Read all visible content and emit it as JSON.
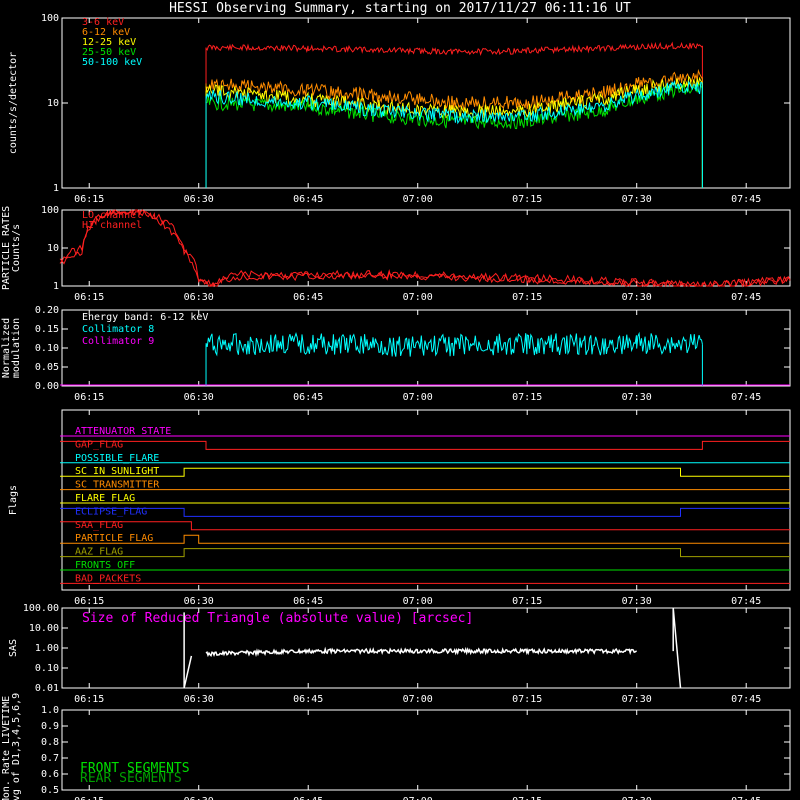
{
  "title": "HESSI Observing Summary, starting on 2017/11/27 06:11:16 UT",
  "colors": {
    "background": "#000000",
    "axes": "#ffffff",
    "red": "#ff2020",
    "orange": "#ff8c00",
    "yellow": "#ffff00",
    "green": "#00e000",
    "cyan": "#00ffff",
    "magenta": "#ff00ff",
    "blue": "#2030ff",
    "olive": "#a0a000",
    "white": "#ffffff"
  },
  "time_ticks": [
    "06:15",
    "06:30",
    "06:45",
    "07:00",
    "07:15",
    "07:30",
    "07:45"
  ],
  "chart_data": [
    {
      "type": "line",
      "name": "count-rates",
      "ylabel": "counts/s/detector",
      "yscale": "log",
      "ylim": [
        1,
        100
      ],
      "ytick_labels": [
        "1",
        "10",
        "100"
      ],
      "x": [
        "06:11",
        "06:31",
        "06:45",
        "06:55",
        "07:05",
        "07:15",
        "07:25",
        "07:35",
        "07:39",
        "07:51"
      ],
      "series": [
        {
          "name": "3-6 keV",
          "color": "#ff2020",
          "values": [
            1,
            45,
            44,
            42,
            40,
            41,
            44,
            47,
            47,
            1
          ]
        },
        {
          "name": "6-12 keV",
          "color": "#ff8c00",
          "values": [
            1,
            17,
            14,
            12,
            10,
            10,
            13,
            20,
            20,
            1
          ]
        },
        {
          "name": "12-25 keV",
          "color": "#ffff00",
          "values": [
            1,
            14,
            11,
            9,
            8,
            8,
            11,
            17,
            17,
            1
          ]
        },
        {
          "name": "25-50 keV",
          "color": "#00e000",
          "values": [
            1,
            10,
            9,
            7,
            6,
            6,
            8,
            14,
            14,
            1
          ]
        },
        {
          "name": "50-100 keV",
          "color": "#00ffff",
          "values": [
            1,
            12,
            10,
            8,
            7,
            7,
            9,
            15,
            15,
            1
          ]
        }
      ]
    },
    {
      "type": "line",
      "name": "particle-rates",
      "ylabel": "PARTICLE RATES\nCounts/s",
      "yscale": "log",
      "ylim": [
        1,
        100
      ],
      "ytick_labels": [
        "1",
        "10",
        "100"
      ],
      "x": [
        "06:11",
        "06:14",
        "06:16",
        "06:18",
        "06:20",
        "06:22",
        "06:24",
        "06:26",
        "06:28",
        "06:30",
        "06:32",
        "06:35",
        "07:00",
        "07:39",
        "07:51"
      ],
      "series": [
        {
          "name": "LO channel",
          "color": "#ff2020",
          "values": [
            5,
            10,
            60,
            95,
            100,
            90,
            70,
            40,
            10,
            1.5,
            1,
            2,
            2,
            1,
            1.5
          ]
        },
        {
          "name": "HI channel",
          "color": "#ff2020",
          "values": [
            4,
            8,
            50,
            85,
            95,
            85,
            60,
            30,
            8,
            1.2,
            1,
            1.8,
            1.8,
            1,
            1.4
          ]
        }
      ]
    },
    {
      "type": "line",
      "name": "modulation",
      "ylabel": "Normalized\nmodulation",
      "ylim": [
        0,
        0.2
      ],
      "ytick_labels": [
        "0.00",
        "0.05",
        "0.10",
        "0.15",
        "0.20"
      ],
      "annotation": "Energy band: 6-12 keV",
      "x": [
        "06:11",
        "06:31",
        "06:45",
        "07:00",
        "07:15",
        "07:30",
        "07:39",
        "07:51"
      ],
      "series": [
        {
          "name": "Collimator 8",
          "color": "#00ffff",
          "values": [
            0,
            0.11,
            0.11,
            0.105,
            0.11,
            0.11,
            0.11,
            0
          ]
        },
        {
          "name": "Collimator 9",
          "color": "#ff00ff",
          "values": [
            0,
            0,
            0,
            0,
            0,
            0,
            0,
            0
          ]
        }
      ]
    },
    {
      "type": "line",
      "name": "flags",
      "ylabel": "Flags",
      "series": [
        {
          "name": "ATTENUATOR_STATE",
          "color": "#ff00ff",
          "x": [
            "06:11",
            "07:51"
          ],
          "values": [
            0,
            0
          ]
        },
        {
          "name": "GAP_FLAG",
          "color": "#ff2020",
          "x": [
            "06:11",
            "06:31",
            "07:39",
            "07:51"
          ],
          "values": [
            1,
            0,
            1,
            1
          ]
        },
        {
          "name": "POSSIBLE_FLARE",
          "color": "#00ffff",
          "x": [
            "06:11",
            "07:51"
          ],
          "values": [
            0,
            0
          ]
        },
        {
          "name": "SC_IN_SUNLIGHT",
          "color": "#ffff00",
          "x": [
            "06:11",
            "06:28",
            "07:36",
            "07:51"
          ],
          "values": [
            0,
            1,
            0,
            0
          ]
        },
        {
          "name": "SC_TRANSMITTER",
          "color": "#ff8c00",
          "x": [
            "06:11",
            "07:51"
          ],
          "values": [
            0,
            0
          ]
        },
        {
          "name": "FLARE_FLAG",
          "color": "#ffff00",
          "x": [
            "06:11",
            "07:51"
          ],
          "values": [
            0,
            0
          ]
        },
        {
          "name": "ECLIPSE_FLAG",
          "color": "#2030ff",
          "x": [
            "06:11",
            "06:28",
            "07:36",
            "07:51"
          ],
          "values": [
            1,
            0,
            1,
            1
          ]
        },
        {
          "name": "SAA_FLAG",
          "color": "#ff2020",
          "x": [
            "06:11",
            "06:29",
            "07:51"
          ],
          "values": [
            1,
            0,
            0
          ]
        },
        {
          "name": "PARTICLE_FLAG",
          "color": "#ff8c00",
          "x": [
            "06:11",
            "06:28",
            "06:30",
            "07:51"
          ],
          "values": [
            0,
            1,
            0,
            0
          ]
        },
        {
          "name": "AAZ_FLAG",
          "color": "#a0a000",
          "x": [
            "06:11",
            "06:28",
            "07:36",
            "07:51"
          ],
          "values": [
            0,
            1,
            0,
            0
          ]
        },
        {
          "name": "FRONTS_OFF",
          "color": "#00e000",
          "x": [
            "06:11",
            "07:51"
          ],
          "values": [
            0,
            0
          ]
        },
        {
          "name": "BAD_PACKETS",
          "color": "#ff2020",
          "x": [
            "06:11",
            "07:51"
          ],
          "values": [
            0,
            0
          ]
        }
      ]
    },
    {
      "type": "line",
      "name": "sas",
      "ylabel": "SAS",
      "yscale": "log",
      "ylim": [
        0.01,
        100
      ],
      "ytick_labels": [
        "0.01",
        "0.10",
        "1.00",
        "10.00",
        "100.00"
      ],
      "annotation": "Size of Reduced Triangle (absolute value) [arcsec]",
      "x": [
        "06:28",
        "06:29",
        "06:31",
        "06:45",
        "07:00",
        "07:15",
        "07:30",
        "07:35",
        "07:36"
      ],
      "series": [
        {
          "name": "",
          "color": "#ffffff",
          "values": [
            60,
            0.4,
            0.5,
            0.7,
            0.7,
            0.7,
            0.7,
            0.7,
            0.02
          ]
        }
      ]
    },
    {
      "type": "line",
      "name": "livetime",
      "ylabel": "Mon. Rate LIVETIME\navg of D1,3,4,5,6,9",
      "ylim": [
        0.5,
        1.0
      ],
      "ytick_labels": [
        "0.5",
        "0.6",
        "0.7",
        "0.8",
        "0.9",
        "1.0"
      ],
      "series": [
        {
          "name": "FRONT SEGMENTS",
          "color": "#00e000",
          "values": []
        },
        {
          "name": "REAR SEGMENTS",
          "color": "#00a000",
          "values": []
        }
      ]
    }
  ]
}
